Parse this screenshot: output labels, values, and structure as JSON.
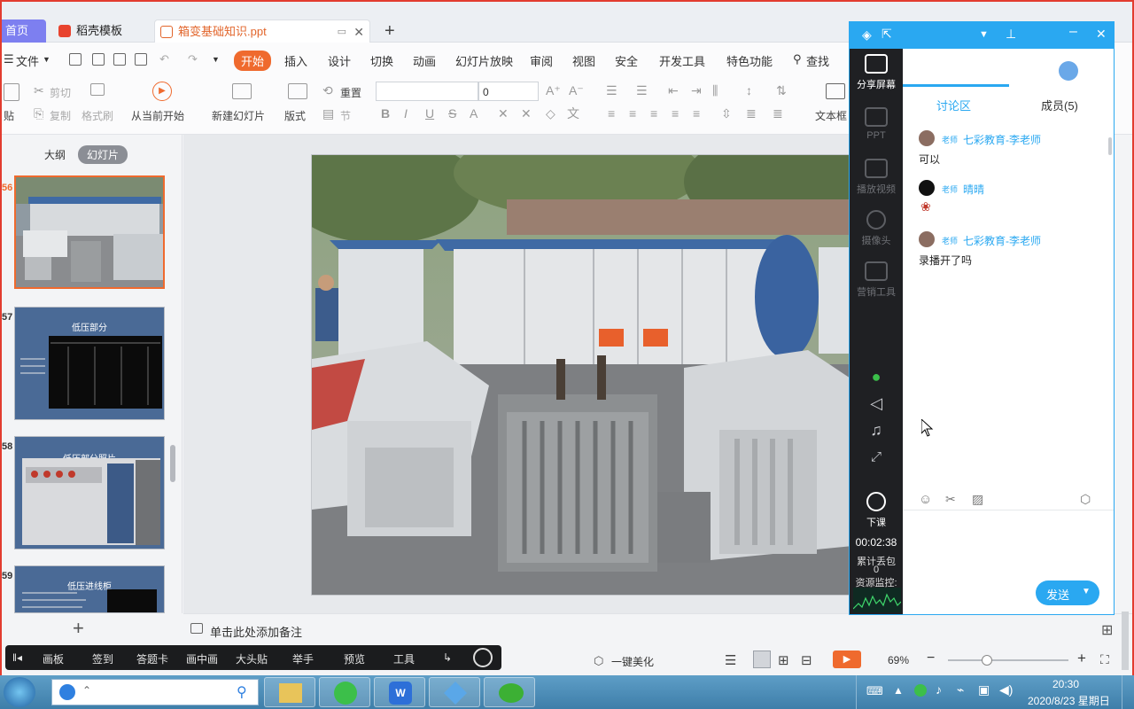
{
  "tabs": {
    "home": "首页",
    "templates": "稻壳模板",
    "document": "箱变基础知识.ppt"
  },
  "menu": {
    "file": "文件",
    "items": [
      "开始",
      "插入",
      "设计",
      "切换",
      "动画",
      "幻灯片放映",
      "审阅",
      "视图",
      "安全",
      "开发工具",
      "特色功能"
    ],
    "search": "查找"
  },
  "ribbon": {
    "paste": "贴",
    "cut": "剪切",
    "copy": "复制",
    "format_painter": "格式刷",
    "play_from_current": "从当前开始",
    "new_slide": "新建幻灯片",
    "layout": "版式",
    "reset": "重置",
    "section": "节",
    "font_size_value": "0",
    "textbox": "文本框"
  },
  "slide_pane": {
    "tab_outline": "大纲",
    "tab_slides": "幻灯片",
    "slides": [
      {
        "num": "56",
        "title": ""
      },
      {
        "num": "57",
        "title": "低压部分"
      },
      {
        "num": "58",
        "title": "低压部分照片"
      },
      {
        "num": "59",
        "title": "低压进线柜"
      }
    ]
  },
  "notes": {
    "placeholder": "单击此处添加备注"
  },
  "statusbar": {
    "beautify": "一键美化",
    "zoom": "69%"
  },
  "class_toolbar": {
    "items": [
      "画板",
      "签到",
      "答题卡",
      "画中画",
      "大头贴",
      "举手",
      "预览",
      "工具"
    ]
  },
  "chat_panel": {
    "side": {
      "share_screen": "分享屏幕",
      "ppt": "PPT",
      "play_video": "播放视频",
      "camera": "摄像头",
      "marketing": "营销工具",
      "end_class": "下课",
      "timer": "00:02:38",
      "packet_loss_label": "累计丢包",
      "packet_loss_value": "0",
      "resource_monitor": "资源监控:"
    },
    "tabs": {
      "discussion": "讨论区",
      "members": "成员(5)"
    },
    "messages": [
      {
        "role": "老师",
        "name": "七彩教育-李老师",
        "text": "可以"
      },
      {
        "role": "老师",
        "name": "晴晴",
        "text": ""
      },
      {
        "role": "老师",
        "name": "七彩教育-李老师",
        "text": "录播开了吗"
      }
    ],
    "send": "发送"
  },
  "taskbar": {
    "time": "20:30",
    "date": "2020/8/23 星期日"
  },
  "colors": {
    "accent_orange": "#ef6a2e",
    "chat_blue": "#2aa8f1",
    "window_border": "#e23c2f"
  }
}
